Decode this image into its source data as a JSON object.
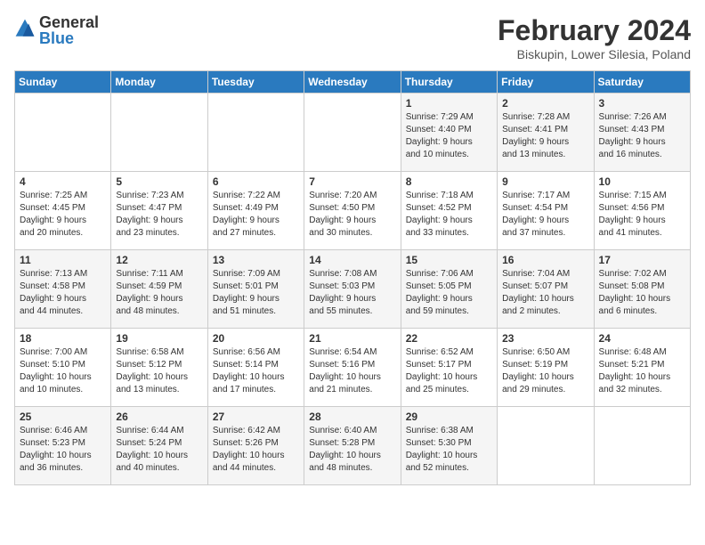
{
  "header": {
    "logo_general": "General",
    "logo_blue": "Blue",
    "month_year": "February 2024",
    "location": "Biskupin, Lower Silesia, Poland"
  },
  "days_of_week": [
    "Sunday",
    "Monday",
    "Tuesday",
    "Wednesday",
    "Thursday",
    "Friday",
    "Saturday"
  ],
  "weeks": [
    [
      {
        "day": "",
        "info": ""
      },
      {
        "day": "",
        "info": ""
      },
      {
        "day": "",
        "info": ""
      },
      {
        "day": "",
        "info": ""
      },
      {
        "day": "1",
        "info": "Sunrise: 7:29 AM\nSunset: 4:40 PM\nDaylight: 9 hours\nand 10 minutes."
      },
      {
        "day": "2",
        "info": "Sunrise: 7:28 AM\nSunset: 4:41 PM\nDaylight: 9 hours\nand 13 minutes."
      },
      {
        "day": "3",
        "info": "Sunrise: 7:26 AM\nSunset: 4:43 PM\nDaylight: 9 hours\nand 16 minutes."
      }
    ],
    [
      {
        "day": "4",
        "info": "Sunrise: 7:25 AM\nSunset: 4:45 PM\nDaylight: 9 hours\nand 20 minutes."
      },
      {
        "day": "5",
        "info": "Sunrise: 7:23 AM\nSunset: 4:47 PM\nDaylight: 9 hours\nand 23 minutes."
      },
      {
        "day": "6",
        "info": "Sunrise: 7:22 AM\nSunset: 4:49 PM\nDaylight: 9 hours\nand 27 minutes."
      },
      {
        "day": "7",
        "info": "Sunrise: 7:20 AM\nSunset: 4:50 PM\nDaylight: 9 hours\nand 30 minutes."
      },
      {
        "day": "8",
        "info": "Sunrise: 7:18 AM\nSunset: 4:52 PM\nDaylight: 9 hours\nand 33 minutes."
      },
      {
        "day": "9",
        "info": "Sunrise: 7:17 AM\nSunset: 4:54 PM\nDaylight: 9 hours\nand 37 minutes."
      },
      {
        "day": "10",
        "info": "Sunrise: 7:15 AM\nSunset: 4:56 PM\nDaylight: 9 hours\nand 41 minutes."
      }
    ],
    [
      {
        "day": "11",
        "info": "Sunrise: 7:13 AM\nSunset: 4:58 PM\nDaylight: 9 hours\nand 44 minutes."
      },
      {
        "day": "12",
        "info": "Sunrise: 7:11 AM\nSunset: 4:59 PM\nDaylight: 9 hours\nand 48 minutes."
      },
      {
        "day": "13",
        "info": "Sunrise: 7:09 AM\nSunset: 5:01 PM\nDaylight: 9 hours\nand 51 minutes."
      },
      {
        "day": "14",
        "info": "Sunrise: 7:08 AM\nSunset: 5:03 PM\nDaylight: 9 hours\nand 55 minutes."
      },
      {
        "day": "15",
        "info": "Sunrise: 7:06 AM\nSunset: 5:05 PM\nDaylight: 9 hours\nand 59 minutes."
      },
      {
        "day": "16",
        "info": "Sunrise: 7:04 AM\nSunset: 5:07 PM\nDaylight: 10 hours\nand 2 minutes."
      },
      {
        "day": "17",
        "info": "Sunrise: 7:02 AM\nSunset: 5:08 PM\nDaylight: 10 hours\nand 6 minutes."
      }
    ],
    [
      {
        "day": "18",
        "info": "Sunrise: 7:00 AM\nSunset: 5:10 PM\nDaylight: 10 hours\nand 10 minutes."
      },
      {
        "day": "19",
        "info": "Sunrise: 6:58 AM\nSunset: 5:12 PM\nDaylight: 10 hours\nand 13 minutes."
      },
      {
        "day": "20",
        "info": "Sunrise: 6:56 AM\nSunset: 5:14 PM\nDaylight: 10 hours\nand 17 minutes."
      },
      {
        "day": "21",
        "info": "Sunrise: 6:54 AM\nSunset: 5:16 PM\nDaylight: 10 hours\nand 21 minutes."
      },
      {
        "day": "22",
        "info": "Sunrise: 6:52 AM\nSunset: 5:17 PM\nDaylight: 10 hours\nand 25 minutes."
      },
      {
        "day": "23",
        "info": "Sunrise: 6:50 AM\nSunset: 5:19 PM\nDaylight: 10 hours\nand 29 minutes."
      },
      {
        "day": "24",
        "info": "Sunrise: 6:48 AM\nSunset: 5:21 PM\nDaylight: 10 hours\nand 32 minutes."
      }
    ],
    [
      {
        "day": "25",
        "info": "Sunrise: 6:46 AM\nSunset: 5:23 PM\nDaylight: 10 hours\nand 36 minutes."
      },
      {
        "day": "26",
        "info": "Sunrise: 6:44 AM\nSunset: 5:24 PM\nDaylight: 10 hours\nand 40 minutes."
      },
      {
        "day": "27",
        "info": "Sunrise: 6:42 AM\nSunset: 5:26 PM\nDaylight: 10 hours\nand 44 minutes."
      },
      {
        "day": "28",
        "info": "Sunrise: 6:40 AM\nSunset: 5:28 PM\nDaylight: 10 hours\nand 48 minutes."
      },
      {
        "day": "29",
        "info": "Sunrise: 6:38 AM\nSunset: 5:30 PM\nDaylight: 10 hours\nand 52 minutes."
      },
      {
        "day": "",
        "info": ""
      },
      {
        "day": "",
        "info": ""
      }
    ]
  ]
}
